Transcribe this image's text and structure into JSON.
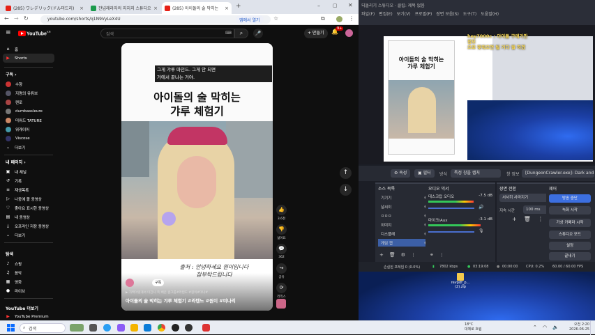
{
  "browser": {
    "tabs": [
      {
        "label": "(285) ワレデリック(ドル미드리)",
        "color": "#e62117"
      },
      {
        "label": "잔넘래라자의 지지지 스튜디오",
        "color": "#1a9a4b"
      },
      {
        "label": "(285) 아이돌의 술 막히는",
        "color": "#e62117"
      }
    ],
    "url": "youtube.com/shorts/q1N9VyLeX4U",
    "open_app_label": "앱에서 열기"
  },
  "youtube": {
    "logo": "YouTube",
    "logo_sup": "KR",
    "search_placeholder": "검색",
    "create_label": "+ 만들기",
    "notif_count": "9+",
    "sidebar": {
      "top": [
        {
          "icon": "home-icon",
          "glyph": "⌂",
          "label": "홈"
        },
        {
          "icon": "shorts-icon",
          "glyph": "▶",
          "label": "Shorts",
          "selected": true
        }
      ],
      "subs_heading": "구독 ›",
      "subs": [
        {
          "label": "수향",
          "color": "#c33"
        },
        {
          "label": "지평의 유튜브",
          "color": "#556"
        },
        {
          "label": "렌로",
          "color": "#a44"
        },
        {
          "label": "dumbassleure",
          "color": "#777"
        },
        {
          "label": "미워드 TATURE",
          "color": "#c86"
        },
        {
          "label": "워캐이어",
          "color": "#49a"
        },
        {
          "label": "Viscose",
          "color": "#336"
        }
      ],
      "more1": "더보기",
      "me_heading": "내 페이지 ›",
      "me": [
        {
          "glyph": "▣",
          "label": "내 채널"
        },
        {
          "glyph": "↺",
          "label": "기록"
        },
        {
          "glyph": "≡",
          "label": "재생목록"
        },
        {
          "glyph": "▷",
          "label": "나중에 볼 동영상"
        },
        {
          "glyph": "♡",
          "label": "좋아요 표시한 동영상"
        },
        {
          "glyph": "▤",
          "label": "내 동영상"
        },
        {
          "glyph": "⤓",
          "label": "오프라인 저장 동영상"
        }
      ],
      "more2": "더보기",
      "explore_heading": "탐색",
      "explore": [
        {
          "glyph": "♪",
          "label": "쇼핑"
        },
        {
          "glyph": "♫",
          "label": "음악"
        },
        {
          "glyph": "▦",
          "label": "영화"
        },
        {
          "glyph": "●",
          "label": "라이브"
        }
      ],
      "more_yt_heading": "YouTube 더보기",
      "premium": "YouTube Premium"
    },
    "short": {
      "caption_line1": "그게 갸루 마인드. 그게 안 되면",
      "caption_line2": "거에서 끝나는 거야.",
      "title_line1": "아이돌의 술 막히는",
      "title_line2": "갸루 체험기",
      "handwritten_line1": "출처 : 안녕하세요 원이입니다",
      "handwritten_line2": "참부탁드립니다",
      "subscribe": "구독",
      "tag_line": "▶ 가백이렇게서 미긴니 쪽 배운 걸그룹#라텐도 #원이#미나#",
      "video_title": "아이돌의 술 막히는 갸루 체험기 #라텐느 #원이 #미나리"
    },
    "actions": [
      {
        "name": "like",
        "glyph": "👍",
        "label": "3.6천"
      },
      {
        "name": "dislike",
        "glyph": "👎",
        "label": "싫어요"
      },
      {
        "name": "comment",
        "glyph": "💬",
        "label": "362"
      },
      {
        "name": "share",
        "glyph": "↪",
        "label": "공유"
      },
      {
        "name": "remix",
        "glyph": "⟳",
        "label": "리믹스"
      }
    ]
  },
  "obs": {
    "title": "되돌리기 스튜디오 · 클립: 제목 없음",
    "menu": [
      "파일(F)",
      "편집(E)",
      "보기(V)",
      "프로필(P)",
      "장면 모음(S)",
      "도구(T)",
      "도움말(H)"
    ],
    "hud_line1": "hey7000c : 아이돌 구매가만정모",
    "hud_line2": "으로 맞춰오면 될 거다 뭘 하겠",
    "toolbar": [
      "⚙ 속성",
      "▣ 필터",
      "방식",
      "특정 창을 캡처",
      "창 정보",
      "[DungeonCrawler.exe]: Dark and"
    ],
    "docks": {
      "sources_title": "소스 목록",
      "sources": [
        {
          "label": "기기기",
          "selected": false
        },
        {
          "label": "날씨이",
          "selected": false
        },
        {
          "label": "ㅁㅁㅁ",
          "selected": false
        },
        {
          "label": "이미지",
          "selected": false
        },
        {
          "label": "디스플레",
          "selected": false
        },
        {
          "label": "게임 캡",
          "selected": true
        }
      ],
      "mixer_title": "오디오 믹서",
      "mixer": [
        {
          "label": "데스크탑 오디오",
          "db": "-7.5 dB",
          "level": 0.72
        },
        {
          "label": "마이크/Aux",
          "db": "-3.1 dB",
          "level": 0.83
        }
      ],
      "transitions_title": "장면 전환",
      "transition_type": "서서히 사라지기",
      "duration_label": "지속 시간",
      "duration_value": "100 ms",
      "controls_title": "제어",
      "controls": [
        "방송 중단",
        "녹화 시작",
        "가상 카메라 시작",
        "스튜디오 모드",
        "설정",
        "끝내기"
      ]
    },
    "status": {
      "dropped": "손실된 프레임 0 (0.0%)",
      "bitrate": "7802 kbps",
      "live": "03:19:08",
      "rec": "00:00:00",
      "cpu": "CPU: 0.2%",
      "fps": "60.00 / 60.00 FPS"
    },
    "desktop_file": "revpdf_p... (2).zip"
  },
  "taskbar": {
    "search": "검색",
    "weather_temp": "18°C",
    "weather_desc": "대체로 흐림",
    "time": "오전 2:20",
    "date": "2026-06-25"
  }
}
